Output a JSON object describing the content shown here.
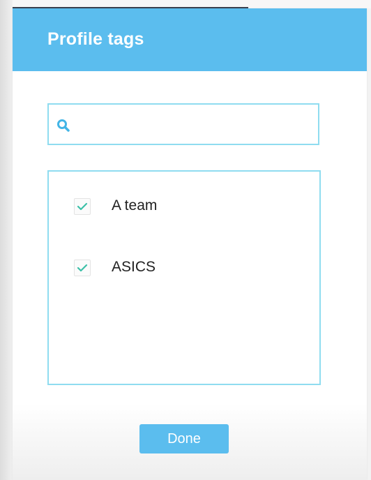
{
  "dialog": {
    "title": "Profile tags"
  },
  "search": {
    "value": "",
    "placeholder": "",
    "icon": "search-icon"
  },
  "tags": [
    {
      "label": "A team",
      "checked": true
    },
    {
      "label": "ASICS",
      "checked": true
    }
  ],
  "footer": {
    "done_label": "Done"
  },
  "colors": {
    "header": "#5bbdee",
    "accent_border": "#8fdcf0",
    "checkmark": "#3cc0a8",
    "button": "#5bbdee"
  }
}
